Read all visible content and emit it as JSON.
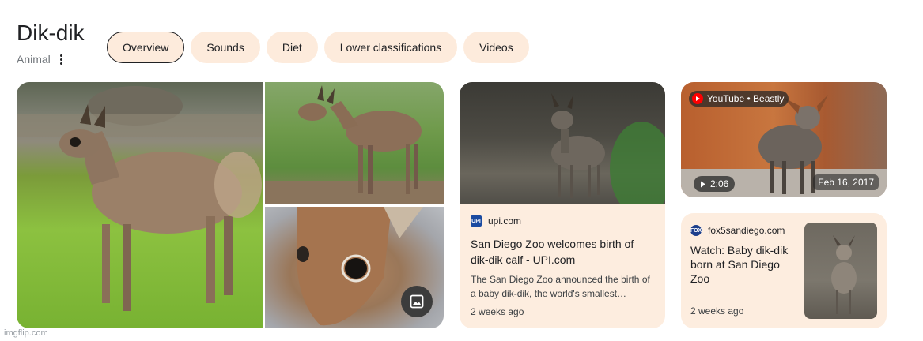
{
  "header": {
    "title": "Dik-dik",
    "subtitle": "Animal"
  },
  "tabs": [
    {
      "label": "Overview",
      "active": true
    },
    {
      "label": "Sounds"
    },
    {
      "label": "Diet"
    },
    {
      "label": "Lower classifications"
    },
    {
      "label": "Videos"
    }
  ],
  "images": [
    {
      "icon": "dik-dik-photo-standing-on-grass"
    },
    {
      "icon": "dik-dik-photo-in-field"
    },
    {
      "icon": "dik-dik-face-closeup-photo"
    }
  ],
  "image_search_button": {
    "icon": "image-search-icon"
  },
  "articles": [
    {
      "source": "upi.com",
      "favicon_text": "UPI",
      "headline": "San Diego Zoo welcomes birth of dik-dik calf - UPI.com",
      "snippet": "The San Diego Zoo announced the birth of a baby dik-dik, the world's smallest…",
      "age": "2 weeks ago"
    },
    {
      "source": "fox5sandiego.com",
      "favicon_text": "FOX",
      "headline": "Watch: Baby dik-dik born at San Diego Zoo",
      "age": "2 weeks ago"
    }
  ],
  "video": {
    "channel": "YouTube • Beastly",
    "duration": "2:06",
    "date": "Feb 16, 2017"
  },
  "watermark": "imgflip.com",
  "colors": {
    "chip_bg": "#fdebdc",
    "card_bg": "#fdeddf",
    "youtube_red": "#ff0000"
  }
}
